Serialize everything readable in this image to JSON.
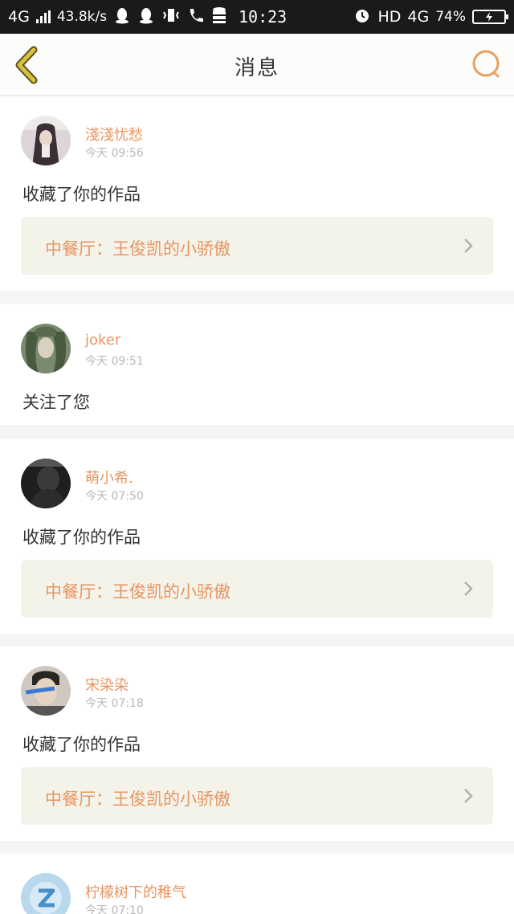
{
  "status_bar": {
    "network_left": "4G",
    "speed": "43.8k/s",
    "time": "10:23",
    "hd": "HD",
    "network_right": "4G",
    "battery": "74%"
  },
  "nav": {
    "title": "消息",
    "back_icon": "chevron-left-icon",
    "search_icon": "search-icon"
  },
  "colors": {
    "accent": "#e89460",
    "back_icon": "#c9b33a",
    "search_icon": "#e8a060"
  },
  "messages": [
    {
      "user": "淺淺忧愁",
      "time": "今天 09:56",
      "action": "收藏了你的作品",
      "work": "中餐厅：王俊凯的小骄傲"
    },
    {
      "user": "joker",
      "time": "今天 09:51",
      "action": "关注了您",
      "work": null
    },
    {
      "user": "萌小希.",
      "time": "今天 07:50",
      "action": "收藏了你的作品",
      "work": "中餐厅：王俊凯的小骄傲"
    },
    {
      "user": "宋染染",
      "time": "今天 07:18",
      "action": "收藏了你的作品",
      "work": "中餐厅：王俊凯的小骄傲"
    },
    {
      "user": "柠檬树下的稚气",
      "time": "今天 07:10",
      "action": "",
      "work": null
    }
  ]
}
